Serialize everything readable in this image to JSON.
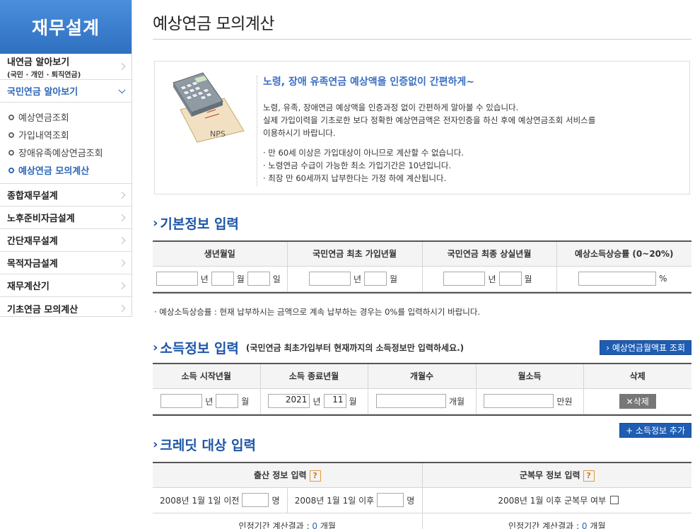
{
  "sidebar": {
    "header": "재무설계",
    "items": [
      {
        "label": "내연금 알아보기",
        "sub": "(국민 · 개인 · 퇴직연금)"
      },
      {
        "label": "국민연금 알아보기"
      },
      {
        "label": "종합재무설계"
      },
      {
        "label": "노후준비자금설계"
      },
      {
        "label": "간단재무설계"
      },
      {
        "label": "목적자금설계"
      },
      {
        "label": "재무계산기"
      },
      {
        "label": "기초연금 모의계산"
      }
    ],
    "subitems": [
      "예상연금조회",
      "가입내역조회",
      "장애유족예상연금조회",
      "예상연금 모의계산"
    ]
  },
  "page": {
    "title": "예상연금 모의계산"
  },
  "info": {
    "headline": "노령, 장애 유족연금 예상액을 인증없이 간편하게~",
    "para1": "노령, 유족, 장애연금 예상액을 인증과정 없이 간편하게 알아볼 수 있습니다.",
    "para2": "실제 가입이력을 기초로한 보다 정확한 예상연금액은 전자인증을 하신 후에 예상연금조회 서비스를",
    "para3": "이용하시기 바랍니다.",
    "bullet1": "· 만 60세 이상은 가입대상이 아니므로 계산할 수 없습니다.",
    "bullet2": "· 노령연금 수급이 가능한 최소 가입기간은 10년입니다.",
    "bullet3": "· 최장 만 60세까지 납부한다는 가정 하에 계산됩니다.",
    "image_label": "NPS"
  },
  "basic": {
    "title": "기본정보 입력",
    "headers": [
      "생년월일",
      "국민연금 최초 가입년월",
      "국민연금 최종 상실년월",
      "예상소득상승률 (0~20%)"
    ],
    "unit_year": "년",
    "unit_month": "월",
    "unit_day": "일",
    "unit_percent": "%",
    "note": "· 예상소득상승률 : 현재 납부하시는 금액으로 계속 납부하는 경우는 0%를 입력하시기 바랍니다."
  },
  "income": {
    "title": "소득정보 입력",
    "note": "(국민연금 최초가입부터 현재까지의 소득정보만 입력하세요.)",
    "table_button": "› 예상연금월액표 조회",
    "headers": [
      "소득 시작년월",
      "소득 종료년월",
      "개월수",
      "월소득",
      "삭제"
    ],
    "end_year": "2021",
    "end_month": "11",
    "unit_year": "년",
    "unit_month": "월",
    "unit_months": "개월",
    "unit_manwon": "만원",
    "delete_button": "✕삭제",
    "add_button": "+ 소득정보 추가"
  },
  "credit": {
    "title": "크레딧 대상 입력",
    "birth_header": "출산 정보 입력",
    "military_header": "군복무 정보 입력",
    "help": "?",
    "before_label": "2008년 1월 1일 이전",
    "after_label": "2008년 1월 1일 이후",
    "unit_person": "명",
    "military_label": "2008년 1월 이후 군복무 여부",
    "result_label": "인정기간 계산결과 :",
    "result_value": "0",
    "result_unit": "개월"
  }
}
